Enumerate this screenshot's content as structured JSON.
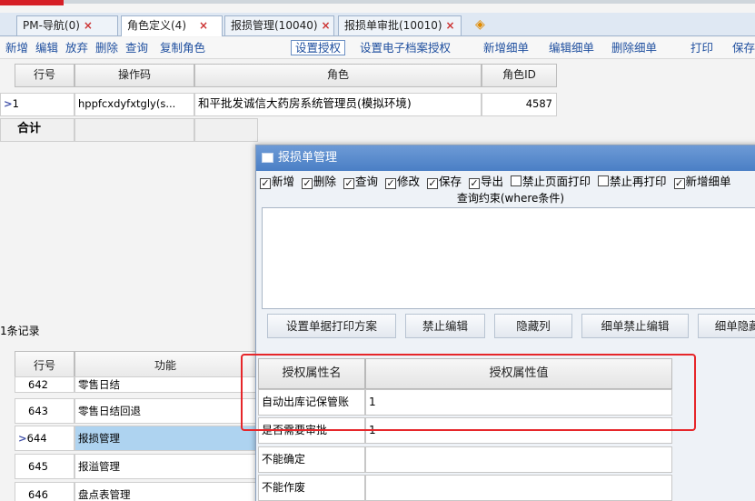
{
  "tabs": [
    {
      "label": "PM-导航(0)",
      "close": "×"
    },
    {
      "label": "角色定义(4)",
      "close": "×"
    },
    {
      "label": "报损管理(10040)",
      "close": "×"
    },
    {
      "label": "报损单审批(10010)",
      "close": "×"
    }
  ],
  "toolbar": [
    "新增",
    "编辑",
    "放弃",
    "删除",
    "查询",
    "复制角色",
    "设置授权",
    "设置电子档案授权",
    "新增细单",
    "编辑细单",
    "删除细单",
    "打印",
    "保存"
  ],
  "role_grid": {
    "headers": [
      "行号",
      "操作码",
      "角色",
      "角色ID"
    ],
    "rows": [
      {
        "rownum": "1",
        "code": "hppfcxdyfxtgly(s...",
        "role": "和平批发诚信大药房系统管理员(模拟环境)",
        "id": "4587"
      }
    ],
    "total_label": "合计",
    "record_count": "1条记录"
  },
  "func_grid": {
    "headers": [
      "行号",
      "功能"
    ],
    "rows": [
      {
        "rownum": "642",
        "func": "零售日结"
      },
      {
        "rownum": "643",
        "func": "零售日结回退"
      },
      {
        "rownum": "644",
        "func": "报损管理"
      },
      {
        "rownum": "645",
        "func": "报溢管理"
      },
      {
        "rownum": "646",
        "func": "盘点表管理"
      }
    ]
  },
  "modal": {
    "title": "报损单管理",
    "checks": [
      {
        "label": "新增",
        "checked": true
      },
      {
        "label": "删除",
        "checked": true
      },
      {
        "label": "查询",
        "checked": true
      },
      {
        "label": "修改",
        "checked": true
      },
      {
        "label": "保存",
        "checked": true
      },
      {
        "label": "导出",
        "checked": true
      },
      {
        "label": "禁止页面打印",
        "checked": false
      },
      {
        "label": "禁止再打印",
        "checked": false
      },
      {
        "label": "新增细单",
        "checked": true
      }
    ],
    "where_label": "查询约束(where条件)",
    "buttons": [
      "设置单据打印方案",
      "禁止编辑",
      "隐藏列",
      "细单禁止编辑",
      "细单隐藏列"
    ],
    "auth_headers": [
      "授权属性名",
      "授权属性值"
    ],
    "auth_rows": [
      {
        "name": "自动出库记保管账",
        "value": "1"
      },
      {
        "name": "是否需要审批",
        "value": "1"
      },
      {
        "name": "不能确定",
        "value": ""
      },
      {
        "name": "不能作废",
        "value": ""
      }
    ]
  }
}
